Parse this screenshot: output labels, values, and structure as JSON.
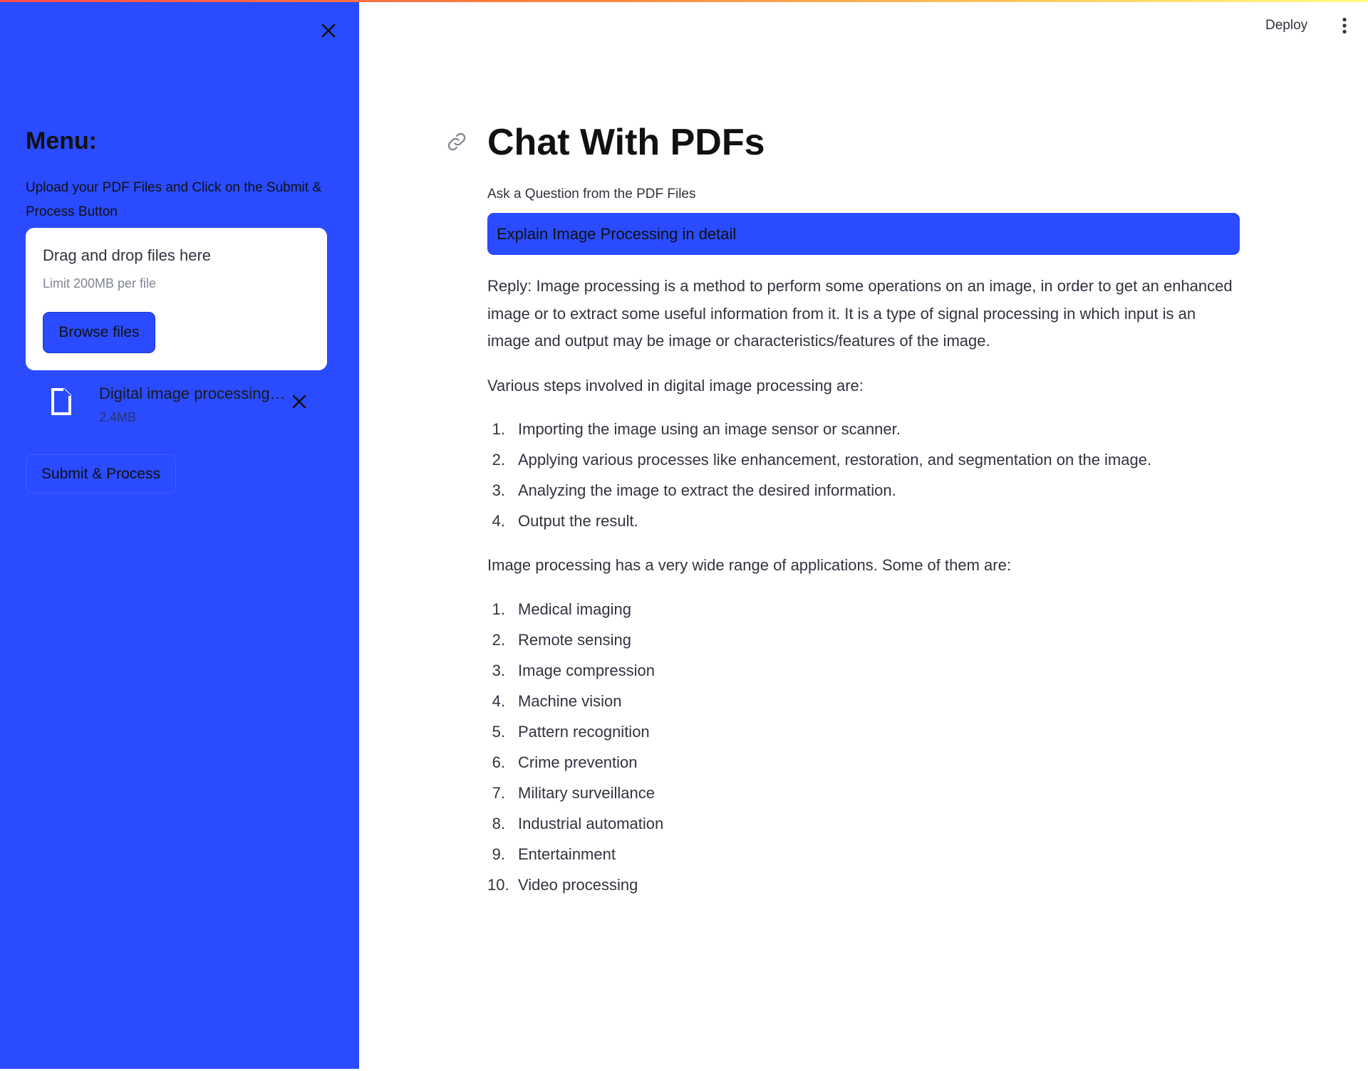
{
  "sidebar": {
    "title": "Menu:",
    "description": "Upload your PDF Files and Click on the Submit & Process Button",
    "uploader": {
      "drag_text": "Drag and drop files here",
      "limit_text": "Limit 200MB per file",
      "browse_label": "Browse files"
    },
    "file": {
      "name": "Digital image processing.pdf",
      "size": "2.4MB"
    },
    "submit_label": "Submit & Process"
  },
  "header": {
    "deploy_label": "Deploy"
  },
  "main": {
    "title": "Chat With PDFs",
    "input_label": "Ask a Question from the PDF Files",
    "input_value": "Explain Image Processing in detail",
    "reply": {
      "intro": "Reply: Image processing is a method to perform some operations on an image, in order to get an enhanced image or to extract some useful information from it. It is a type of signal processing in which input is an image and output may be image or characteristics/features of the image.",
      "steps_intro": "Various steps involved in digital image processing are:",
      "steps": [
        "Importing the image using an image sensor or scanner.",
        "Applying various processes like enhancement, restoration, and segmentation on the image.",
        "Analyzing the image to extract the desired information.",
        "Output the result."
      ],
      "apps_intro": "Image processing has a very wide range of applications. Some of them are:",
      "applications": [
        "Medical imaging",
        "Remote sensing",
        "Image compression",
        "Machine vision",
        "Pattern recognition",
        "Crime prevention",
        "Military surveillance",
        "Industrial automation",
        "Entertainment",
        "Video processing"
      ]
    }
  },
  "colors": {
    "sidebar_bg": "#2a4bff",
    "accent": "#2a4bff",
    "text": "#31333f"
  },
  "icons": {
    "sidebar_close": "close-icon",
    "file": "file-icon",
    "file_remove": "close-icon",
    "heading_link": "link-icon",
    "main_menu": "more-vertical-icon"
  }
}
